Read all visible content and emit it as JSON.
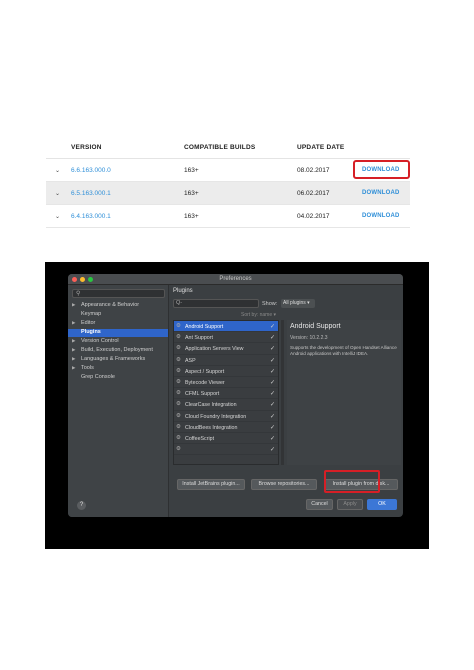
{
  "versions_table": {
    "headers": {
      "version": "VERSION",
      "compatible": "COMPATIBLE BUILDS",
      "date": "UPDATE DATE"
    },
    "rows": [
      {
        "version": "6.6.163.000.0",
        "builds": "163+",
        "date": "08.02.2017",
        "action": "DOWNLOAD"
      },
      {
        "version": "6.5.163.000.1",
        "builds": "163+",
        "date": "06.02.2017",
        "action": "DOWNLOAD"
      },
      {
        "version": "6.4.163.000.1",
        "builds": "163+",
        "date": "04.02.2017",
        "action": "DOWNLOAD"
      }
    ]
  },
  "preferences": {
    "window_title": "Preferences",
    "sidebar": {
      "items": [
        {
          "label": "Appearance & Behavior",
          "arrow": "▶"
        },
        {
          "label": "Keymap",
          "arrow": ""
        },
        {
          "label": "Editor",
          "arrow": "▶"
        },
        {
          "label": "Plugins",
          "arrow": ""
        },
        {
          "label": "Version Control",
          "arrow": "▶"
        },
        {
          "label": "Build, Execution, Deployment",
          "arrow": "▶"
        },
        {
          "label": "Languages & Frameworks",
          "arrow": "▶"
        },
        {
          "label": "Tools",
          "arrow": "▶"
        },
        {
          "label": "Grep Console",
          "arrow": ""
        }
      ],
      "help_label": "?"
    },
    "plugins": {
      "header": "Plugins",
      "search_placeholder": "Q-",
      "show_label": "Show:",
      "show_value": "All plugins ▾",
      "sort_label": "Sort by: name ▾",
      "list": [
        "Android Support",
        "Ant Support",
        "Application Servers View",
        "ASP",
        "Aspect / Support",
        "Bytecode Viewer",
        "CFML Support",
        "ClearCase Integration",
        "Cloud Foundry Integration",
        "CloudBees Integration",
        "CoffeeScript",
        ""
      ],
      "detail": {
        "title": "Android Support",
        "version": "Version: 10.2.2.3",
        "description": "Supports the development of Open Handset Alliance Android applications with IntelliJ IDEA."
      },
      "buttons": {
        "install_jetbrains": "Install JetBrains plugin...",
        "browse": "Browse repositories...",
        "install_disk": "Install plugin from disk..."
      }
    },
    "footer": {
      "cancel": "Cancel",
      "apply": "Apply",
      "ok": "OK"
    }
  },
  "colors": {
    "accent_link": "#2f8fd8",
    "highlight_box": "#d61f26",
    "selection": "#2f65ca",
    "traffic_red": "#fc5f57",
    "traffic_yellow": "#fdbc2e",
    "traffic_green": "#28c840"
  }
}
